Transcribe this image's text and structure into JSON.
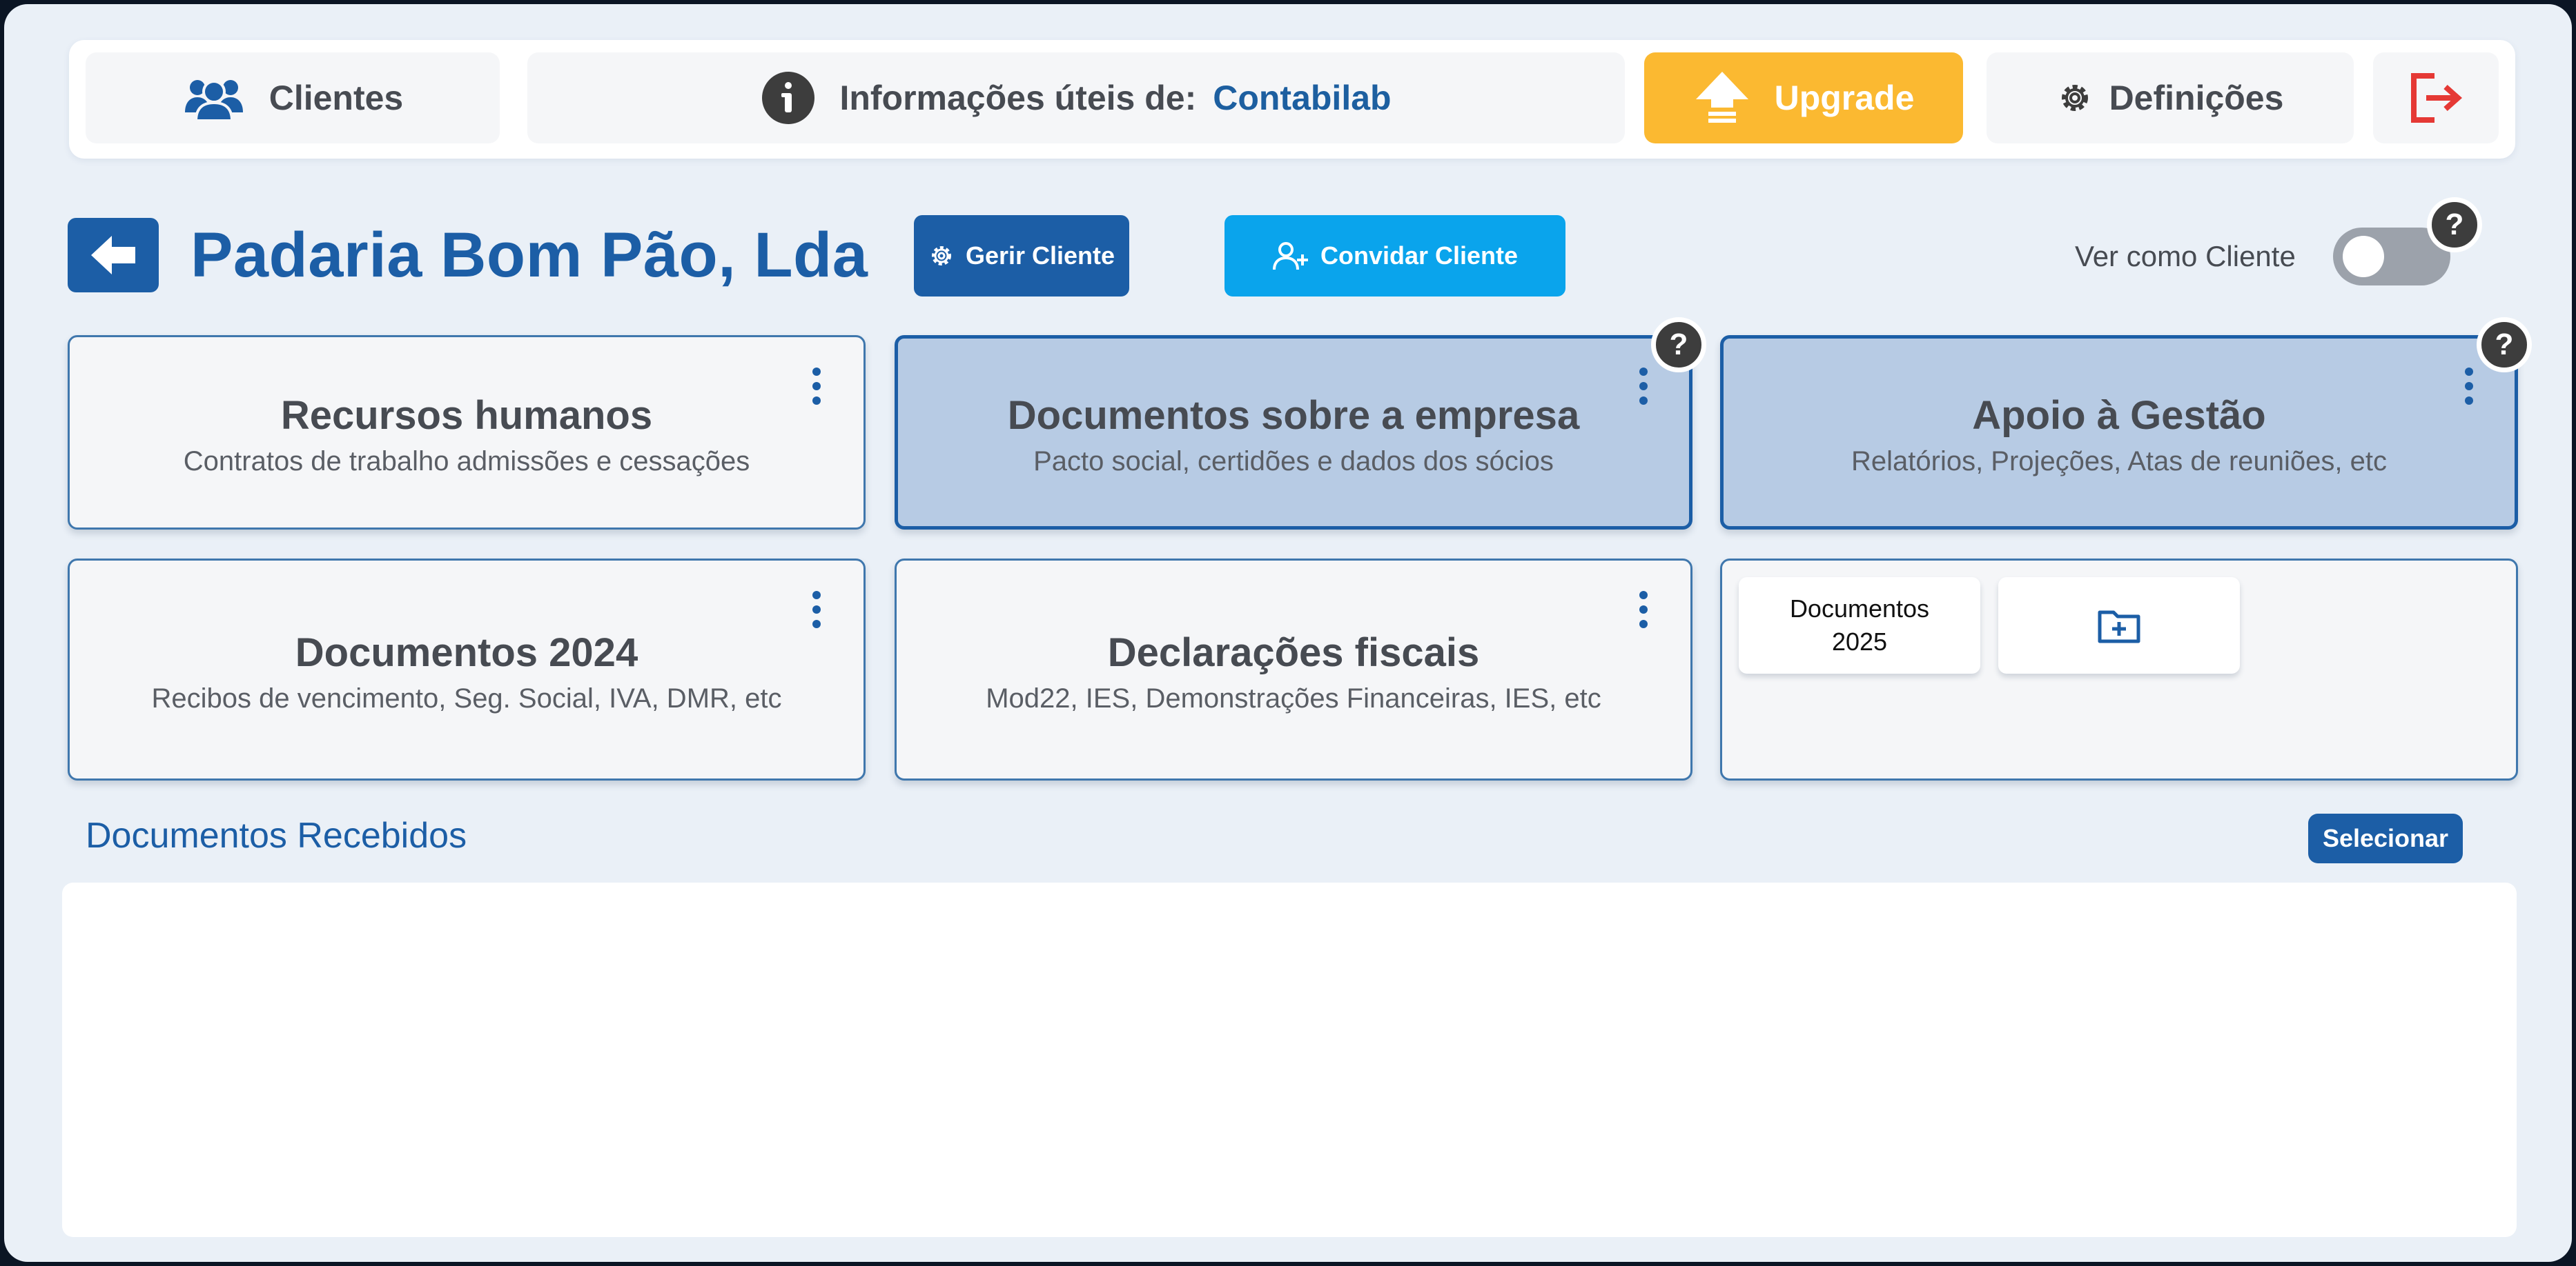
{
  "topbar": {
    "clientes_label": "Clientes",
    "info_label": "Informações úteis de:",
    "info_brand": "Contabilab",
    "upgrade_label": "Upgrade",
    "definicoes_label": "Definições"
  },
  "header": {
    "title": "Padaria Bom Pão, Lda",
    "gerir_label": "Gerir Cliente",
    "convidar_label": "Convidar Cliente",
    "ver_como_label": "Ver como Cliente",
    "help_glyph": "?"
  },
  "cards": [
    {
      "title": "Recursos humanos",
      "subtitle": "Contratos de trabalho admissões e cessações"
    },
    {
      "title": "Documentos sobre a empresa",
      "subtitle": "Pacto social, certidões e dados dos sócios"
    },
    {
      "title": "Apoio à Gestão",
      "subtitle": "Relatórios, Projeções, Atas de reuniões, etc"
    },
    {
      "title": "Documentos 2024",
      "subtitle": "Recibos de vencimento, Seg. Social, IVA, DMR, etc"
    },
    {
      "title": "Declarações fiscais",
      "subtitle": "Mod22, IES, Demonstrações Financeiras, IES, etc"
    }
  ],
  "subfolders": [
    {
      "line1": "Documentos",
      "line2": "2025"
    }
  ],
  "recebidos": {
    "title": "Documentos Recebidos",
    "select_label": "Selecionar"
  },
  "colors": {
    "primary": "#1c5ea6",
    "accent_cyan": "#0aa4ec",
    "upgrade": "#fbb931",
    "logout": "#e53935",
    "background": "#eaf0f7"
  },
  "icons": [
    "users-icon",
    "info-icon",
    "upload-icon",
    "gear-icon",
    "logout-icon",
    "arrow-left-icon",
    "user-plus-icon",
    "help-icon",
    "kebab-icon",
    "folder-plus-icon"
  ]
}
